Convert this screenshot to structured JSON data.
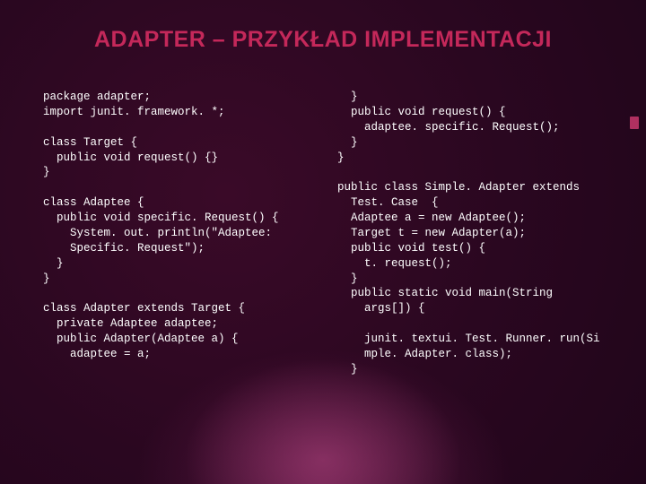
{
  "title": "ADAPTER – PRZYKŁAD IMPLEMENTACJI",
  "code": {
    "left": "package adapter;\nimport junit. framework. *;\n\nclass Target {\n  public void request() {}\n}\n\nclass Adaptee {\n  public void specific. Request() {\n    System. out. println(\"Adaptee:\n    Specific. Request\");\n  }\n}\n\nclass Adapter extends Target {\n  private Adaptee adaptee;\n  public Adapter(Adaptee a) {\n    adaptee = a;",
    "right": "  }\n  public void request() {\n    adaptee. specific. Request();\n  }\n}\n\npublic class Simple. Adapter extends\n  Test. Case  {\n  Adaptee a = new Adaptee();\n  Target t = new Adapter(a);\n  public void test() {\n    t. request();\n  }\n  public static void main(String\n    args[]) {\n\n    junit. textui. Test. Runner. run(Si\n    mple. Adapter. class);\n  }"
  }
}
